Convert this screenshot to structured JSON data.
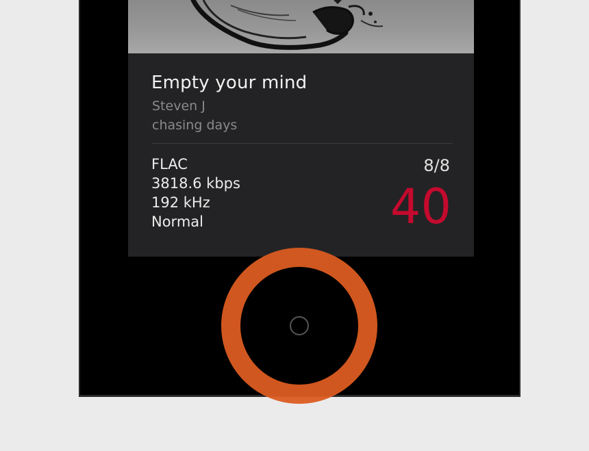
{
  "track": {
    "title": "Empty your mind",
    "artist": "Steven J",
    "album": "chasing days"
  },
  "audio": {
    "format": "FLAC",
    "bitrate": "3818.6 kbps",
    "sample_rate": "192 kHz",
    "mode": "Normal"
  },
  "playlist": {
    "position": "8/8"
  },
  "volume": {
    "value": "40"
  },
  "colors": {
    "volume_accent": "#c40a2e",
    "highlight_ring": "#db5c21",
    "card_background": "#232325",
    "page_background": "#ebebeb"
  },
  "icons": {
    "home_button": "home-button-icon"
  }
}
